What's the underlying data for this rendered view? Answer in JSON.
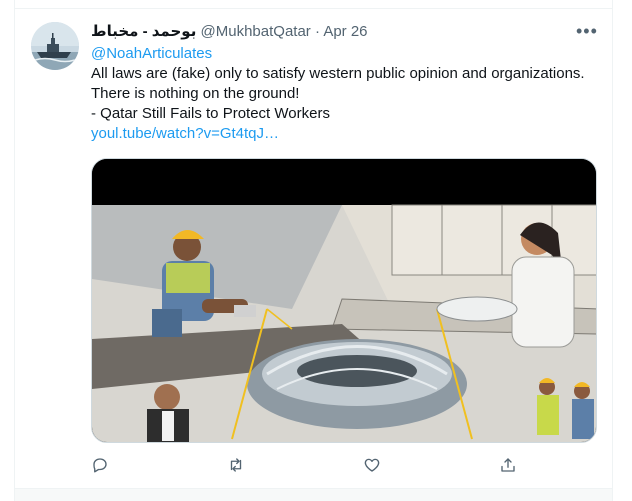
{
  "tweet": {
    "display_name": "بوحمد - مخباط",
    "handle": "@MukhbatQatar",
    "separator": "·",
    "date": "Apr 26",
    "more_label": "•••",
    "reply_to": "@NoahArticulates",
    "lines": [
      "All laws are (fake) only to satisfy western public opinion and organizations.",
      "There is nothing on the ground!",
      "- Qatar Still Fails to Protect Workers"
    ],
    "link": "youl.tube/watch?v=Gt4tqJ…"
  },
  "actions": {
    "icons": [
      "reply-icon",
      "retweet-icon",
      "like-icon",
      "share-icon"
    ]
  },
  "colors": {
    "accent": "#1d9bf0",
    "muted": "#536471",
    "text": "#0f1419",
    "border": "#eff3f4"
  }
}
